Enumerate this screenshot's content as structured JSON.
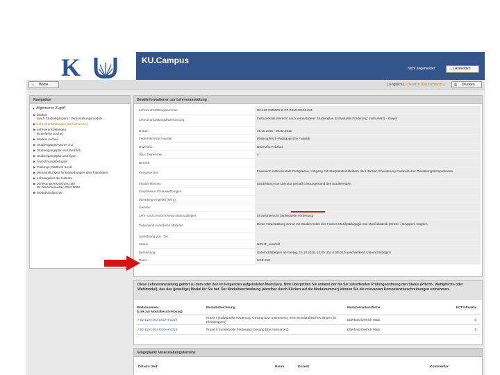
{
  "app": {
    "title": "KU.Campus",
    "logo_alt": "KU"
  },
  "header": {
    "login_status": "Nicht angemeldet",
    "login_button": "Anmelden",
    "home_button": "Home",
    "lang_en": "[ Englisch ]",
    "lang_de": "[ Deutsch (Deutschland) ]",
    "print_button": "Drucken"
  },
  "nav": {
    "title": "Navigation",
    "root": "Allgemeiner Zugriff",
    "items": [
      "Module\n(nach Studiengängen) / Veranstaltungsmodule",
      "Lehrveranstaltungen [Einfachsuche]",
      "Lehrveranstaltungen\n[Erweiterte Suche]",
      "Module suchen",
      "Studiengänge/Fächer A-Z",
      "Studiengangsplan im Überblick",
      "Studiengangsplan anzeigen",
      "Anrechnungsbefugnis",
      "Prüfungs-Plattform ILIAS",
      "Veranstaltungen für Bewerbungen aller Fakultäten",
      "Lehrangebot der Institute",
      "Vorlesungsverzeichnis (alt)\nfür Wintersemester 2007/2008",
      "Modulhandbücher"
    ],
    "active_index": 1
  },
  "detail": {
    "title": "Detailinformationen zur Lehrveranstaltung",
    "rows": [
      {
        "label": "Lehrveranstaltungsnummer",
        "value": "B2-113-CM0501-E-PF-0610.20152.001"
      },
      {
        "label": "Lehrveranstaltungsbezeichnung",
        "value": "Instrumentalunterricht nach veranstalteter Studienplan (Individuelle Förderung: Instrument) - Klavier"
      },
      {
        "label": "Datum",
        "value": "15.10.2015 - 09.02.2016"
      },
      {
        "label": "Federführende Fakultät",
        "value": "Philosophisch-Pädagogische Fakultät"
      },
      {
        "label": "Dozent/in",
        "value": "Dozent/in Felizitas"
      },
      {
        "label": "Max. Teilnehmer",
        "value": "4"
      },
      {
        "label": "Bereich",
        "value": ""
      },
      {
        "label": "Kompetenzen",
        "value": "Erweiterte instrumentale Fertigkeiten, Umgang mit Interpretationsfeldern der Literatur, Erweiterung musikalischer Gestaltungskompetenzen"
      },
      {
        "label": "Inhalte/Themen",
        "value": "Erarbeitung von Literatur gemäß Leistungsstand des Studierenden"
      },
      {
        "label": "Empfohlene Voraussetzungen",
        "value": ""
      },
      {
        "label": "eLearning-Angebot (URL)",
        "value": ""
      },
      {
        "label": "Literatur",
        "value": ""
      },
      {
        "label": "Lehr- und Lernform/Veranstaltungstypen",
        "value": "Einzelunterricht (Individuelle Förderung)"
      },
      {
        "label": "Polyvalenz in anderen Modulen",
        "value": "Diese Veranstaltung ist nur mit Studierenden des Faches Musikpädagogik und Musikdidaktik (Einzel- / Gruppen) möglich."
      },
      {
        "label": "Anmeldung von - bis",
        "value": ""
      },
      {
        "label": "Status",
        "value": "NICHT_namhaft"
      },
      {
        "label": "Bemerkung",
        "value": "Unterrichtsbeginn ab Freitag, 16.10.2015, 10:00 Uhr, KGE-210 anschließend Unterrichtsbeginn"
      },
      {
        "label": "Raum",
        "value": "KGE-210"
      }
    ]
  },
  "modules": {
    "notice": "Diese Lehrveranstaltung gehört zu dem oder den im Folgenden aufgelisteten Modul(en). Bitte überprüfen Sie anhand der für Sie zutreffenden Prüfungsordnung den Status (Pflicht-, Wahlpflicht- oder Wahlmodul), das das (jeweilige) Modul für Sie hat. Der Modulbeschreibung (abrufbar durch Klicken auf die Modulnummer) können Sie die relevanten Kompetenzbeschreibungen entnehmen.",
    "headers": [
      "Modulnummer\n(Link zur Modulbeschreibung)",
      "Modulbezeichnung",
      "Modulverantwortliche",
      "ECTS-Punkte"
    ],
    "rows": [
      {
        "number": "82-1134-MU-SGD-H-0310",
        "name": "Praxis I (Individuelle Förderung: Gesang bzw. Instrument), SSE Schulpraktisches Singen (in Kleingruppen)",
        "owner": "Eberhard Dietrich Mark",
        "ects": "5"
      },
      {
        "number": "82-1134-MU-SGD-H-0310",
        "name": "Praxis II (Individuelle Förderung: Gesang bzw. Instrument)",
        "owner": "Eberhard Dietrich Mark",
        "ects": "5"
      }
    ]
  },
  "dates": {
    "title": "Eingeplante Veranstaltungstermine",
    "headers": [
      "Datum / Zeit",
      "Raum",
      "Dozent",
      "Kommentar"
    ]
  },
  "colors": {
    "title_bar": "#34558b",
    "accent_gold": "#b5880f",
    "annotation_red": "#d11414"
  }
}
